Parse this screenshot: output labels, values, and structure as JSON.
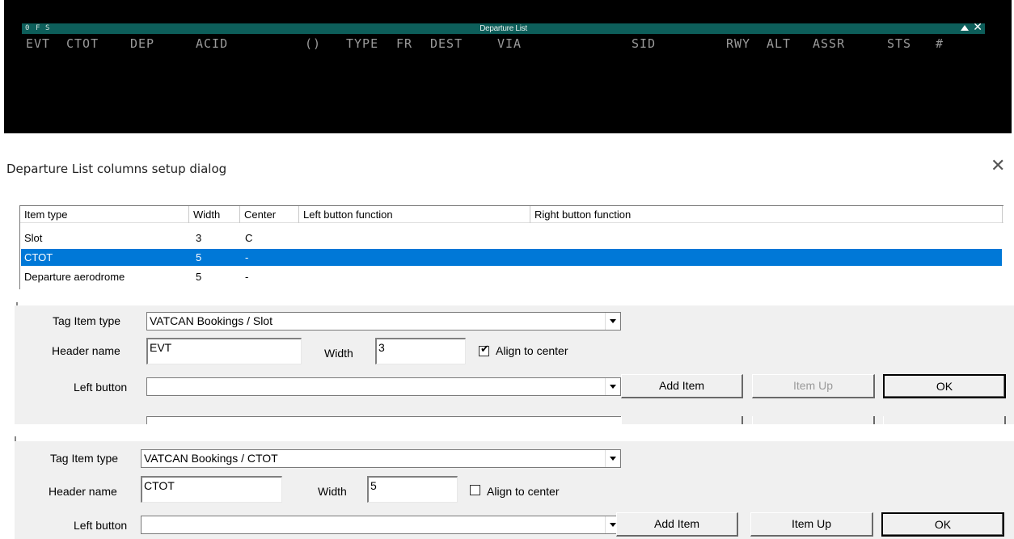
{
  "radar": {
    "title": "Departure List",
    "buttons": [
      "0",
      "F",
      "S"
    ],
    "close_symbol": "✕",
    "headers": [
      "EVT",
      "CTOT",
      "DEP",
      "ACID",
      "()",
      "TYPE",
      "FR",
      "DEST",
      "VIA",
      "SID",
      "RWY",
      "ALT",
      "ASSR",
      "STS",
      "#"
    ]
  },
  "dialog": {
    "title": "Departure List columns setup dialog",
    "close_symbol": "✕",
    "columns": [
      "Item type",
      "Width",
      "Center",
      "Left button function",
      "Right button function"
    ],
    "rows": [
      {
        "item_type": "Slot",
        "width": "3",
        "center": "C",
        "selected": false
      },
      {
        "item_type": "CTOT",
        "width": "5",
        "center": "-",
        "selected": true
      },
      {
        "item_type": "Departure aerodrome",
        "width": "5",
        "center": "-",
        "selected": false
      }
    ]
  },
  "panel1": {
    "tag_item_type_label": "Tag Item type",
    "tag_item_type_value": "VATCAN Bookings / Slot",
    "header_name_label": "Header name",
    "header_name_value": "EVT",
    "width_label": "Width",
    "width_value": "3",
    "align_label": "Align to center",
    "align_checked": true,
    "align_mark": "✔",
    "left_button_label": "Left button",
    "left_button_value": "",
    "add_item": "Add Item",
    "item_up": "Item Up",
    "ok": "OK"
  },
  "panel2": {
    "tag_item_type_label": "Tag Item type",
    "tag_item_type_value": "VATCAN Bookings / CTOT",
    "header_name_label": "Header name",
    "header_name_value": "CTOT",
    "width_label": "Width",
    "width_value": "5",
    "align_label": "Align to center",
    "align_checked": false,
    "left_button_label": "Left button",
    "left_button_value": "",
    "add_item": "Add Item",
    "item_up": "Item Up",
    "ok": "OK"
  }
}
